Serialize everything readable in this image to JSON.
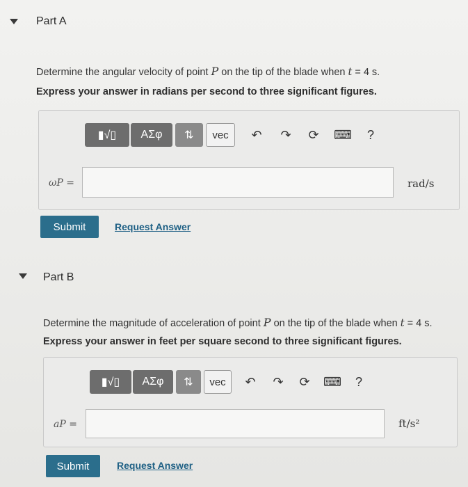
{
  "partA": {
    "title": "Part A",
    "question_pre": "Determine the angular velocity of point ",
    "point": "P",
    "question_mid": " on the tip of the blade when ",
    "time_var": "t",
    "question_post": " = 4 s.",
    "instruction": "Express your answer in radians per second to three significant figures.",
    "var_label": "ωP =",
    "unit": "rad/s",
    "submit_label": "Submit",
    "request_label": "Request Answer"
  },
  "partB": {
    "title": "Part B",
    "question_pre": "Determine the magnitude of acceleration of point ",
    "point": "P",
    "question_mid": " on the tip of the blade when ",
    "time_var": "t",
    "question_post": " = 4 s.",
    "instruction": "Express your answer in feet per square second to three significant figures.",
    "var_label": "aP =",
    "unit": "ft/s²",
    "submit_label": "Submit",
    "request_label": "Request Answer"
  },
  "toolbar": {
    "templates_label": "▮√▯",
    "greek_label": "ΑΣφ",
    "arrows_label": "⇅",
    "vec_label": "vec",
    "undo_glyph": "↶",
    "redo_glyph": "↷",
    "reset_glyph": "⟳",
    "keyboard_glyph": "⌨",
    "help_glyph": "?"
  }
}
